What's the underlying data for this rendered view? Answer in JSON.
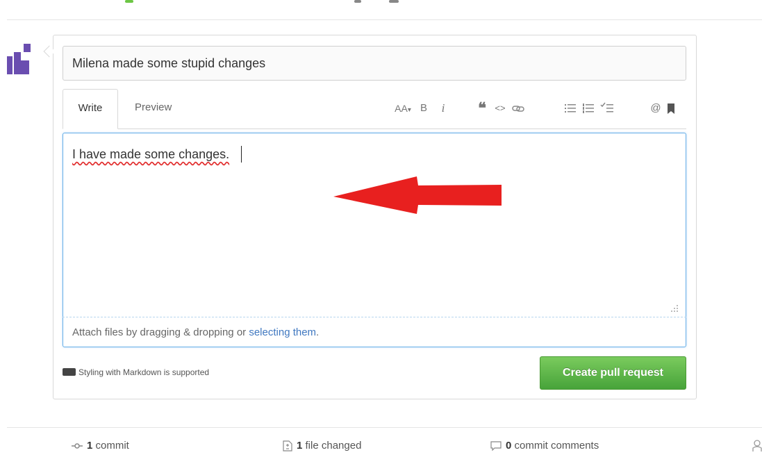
{
  "pull_request": {
    "title_value": "Milena made some stupid changes",
    "tabs": {
      "write": "Write",
      "preview": "Preview"
    },
    "toolbar": {
      "heading": "AA",
      "heading_caret": "▾",
      "bold": "B",
      "italic": "i",
      "quote": "❝",
      "code": "<>",
      "mention": "@"
    },
    "body_text": "I have made some changes.",
    "attach": {
      "prefix": "Attach files by dragging & dropping or ",
      "link": "selecting them",
      "suffix": "."
    },
    "markdown_note": "Styling with Markdown is supported",
    "create_button": "Create pull request"
  },
  "stats": {
    "commits": {
      "count": "1",
      "label": "commit"
    },
    "files": {
      "count": "1",
      "label": "file changed"
    },
    "comments": {
      "count": "0",
      "label": "commit comments"
    }
  },
  "colors": {
    "button_green": "#5cb848",
    "link_blue": "#4078c0",
    "annotation_red": "#e8201f",
    "editor_focus": "#66aee8"
  },
  "icons": [
    "link-icon",
    "unordered-list-icon",
    "ordered-list-icon",
    "task-list-icon",
    "bookmark-icon",
    "markdown-icon",
    "commit-icon",
    "file-diff-icon",
    "comment-icon",
    "contributors-icon"
  ]
}
